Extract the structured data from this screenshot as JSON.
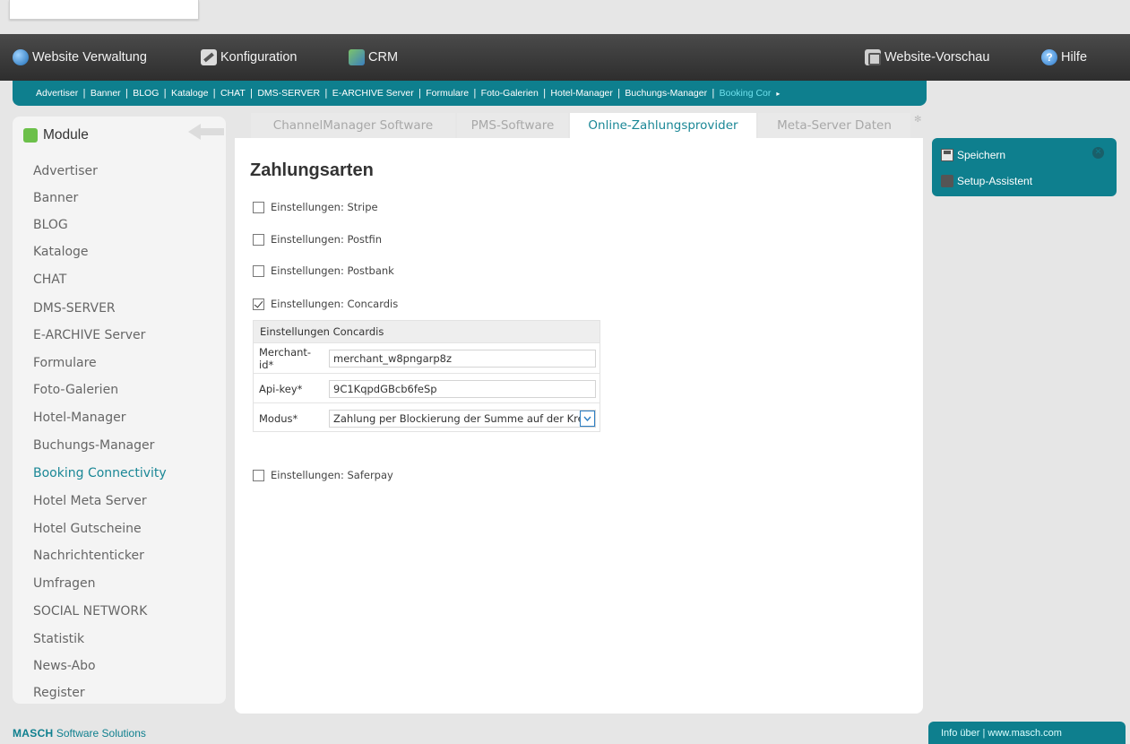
{
  "topbar": {
    "items": [
      {
        "label": "Website Verwaltung",
        "icon": "globe-icon"
      },
      {
        "label": "Konfiguration",
        "icon": "tools-icon"
      },
      {
        "label": "CRM",
        "icon": "crm-icon"
      },
      {
        "label": "Website-Vorschau",
        "icon": "preview-icon"
      },
      {
        "label": "Hilfe",
        "icon": "help-icon"
      }
    ]
  },
  "subnav": {
    "items": [
      "Advertiser",
      "Banner",
      "BLOG",
      "Kataloge",
      "CHAT",
      "DMS-SERVER",
      "E-ARCHIVE Server",
      "Formulare",
      "Foto-Galerien",
      "Hotel-Manager",
      "Buchungs-Manager",
      "Booking Cor"
    ],
    "active_index": 11,
    "separator": "|",
    "more_arrow": "▸"
  },
  "sidebar": {
    "title": "Module",
    "items": [
      "Advertiser",
      "Banner",
      "BLOG",
      "Kataloge",
      "CHAT",
      "DMS-SERVER",
      "E-ARCHIVE Server",
      "Formulare",
      "Foto-Galerien",
      "Hotel-Manager",
      "Buchungs-Manager",
      "Booking Connectivity",
      "Hotel Meta Server",
      "Hotel Gutscheine",
      "Nachrichtenticker",
      "Umfragen",
      "SOCIAL NETWORK",
      "Statistik",
      "News-Abo",
      "Register"
    ],
    "active_index": 11
  },
  "tabs": {
    "items": [
      "ChannelManager Software",
      "PMS-Software",
      "Online-Zahlungsprovider",
      "Meta-Server Daten"
    ],
    "active_index": 2,
    "star": "✻"
  },
  "main": {
    "title": "Zahlungsarten",
    "checkboxes": [
      {
        "label": "Einstellungen: Stripe",
        "checked": false
      },
      {
        "label": "Einstellungen: Postfin",
        "checked": false
      },
      {
        "label": "Einstellungen: Postbank",
        "checked": false
      },
      {
        "label": "Einstellungen: Concardis",
        "checked": true
      },
      {
        "label": "Einstellungen: Saferpay",
        "checked": false
      }
    ],
    "concardis": {
      "title": "Einstellungen Concardis",
      "fields": [
        {
          "label": "Merchant-id*",
          "value": "merchant_w8pngarp8z"
        },
        {
          "label": "Api-key*",
          "value": "9C1KqpdGBcb6feSp"
        },
        {
          "label": "Modus*",
          "value": "Zahlung per Blockierung der Summe auf der Kre"
        }
      ]
    }
  },
  "actions": {
    "save": "Speichern",
    "wizard": "Setup-Assistent"
  },
  "footer": {
    "brand_bold": "MASCH",
    "brand_rest": "Software Solutions",
    "info": "Info über | www.masch.com"
  },
  "colors": {
    "accent": "#0e7f8e",
    "active_text": "#1a8796",
    "topbar": "#3a3a3a"
  }
}
